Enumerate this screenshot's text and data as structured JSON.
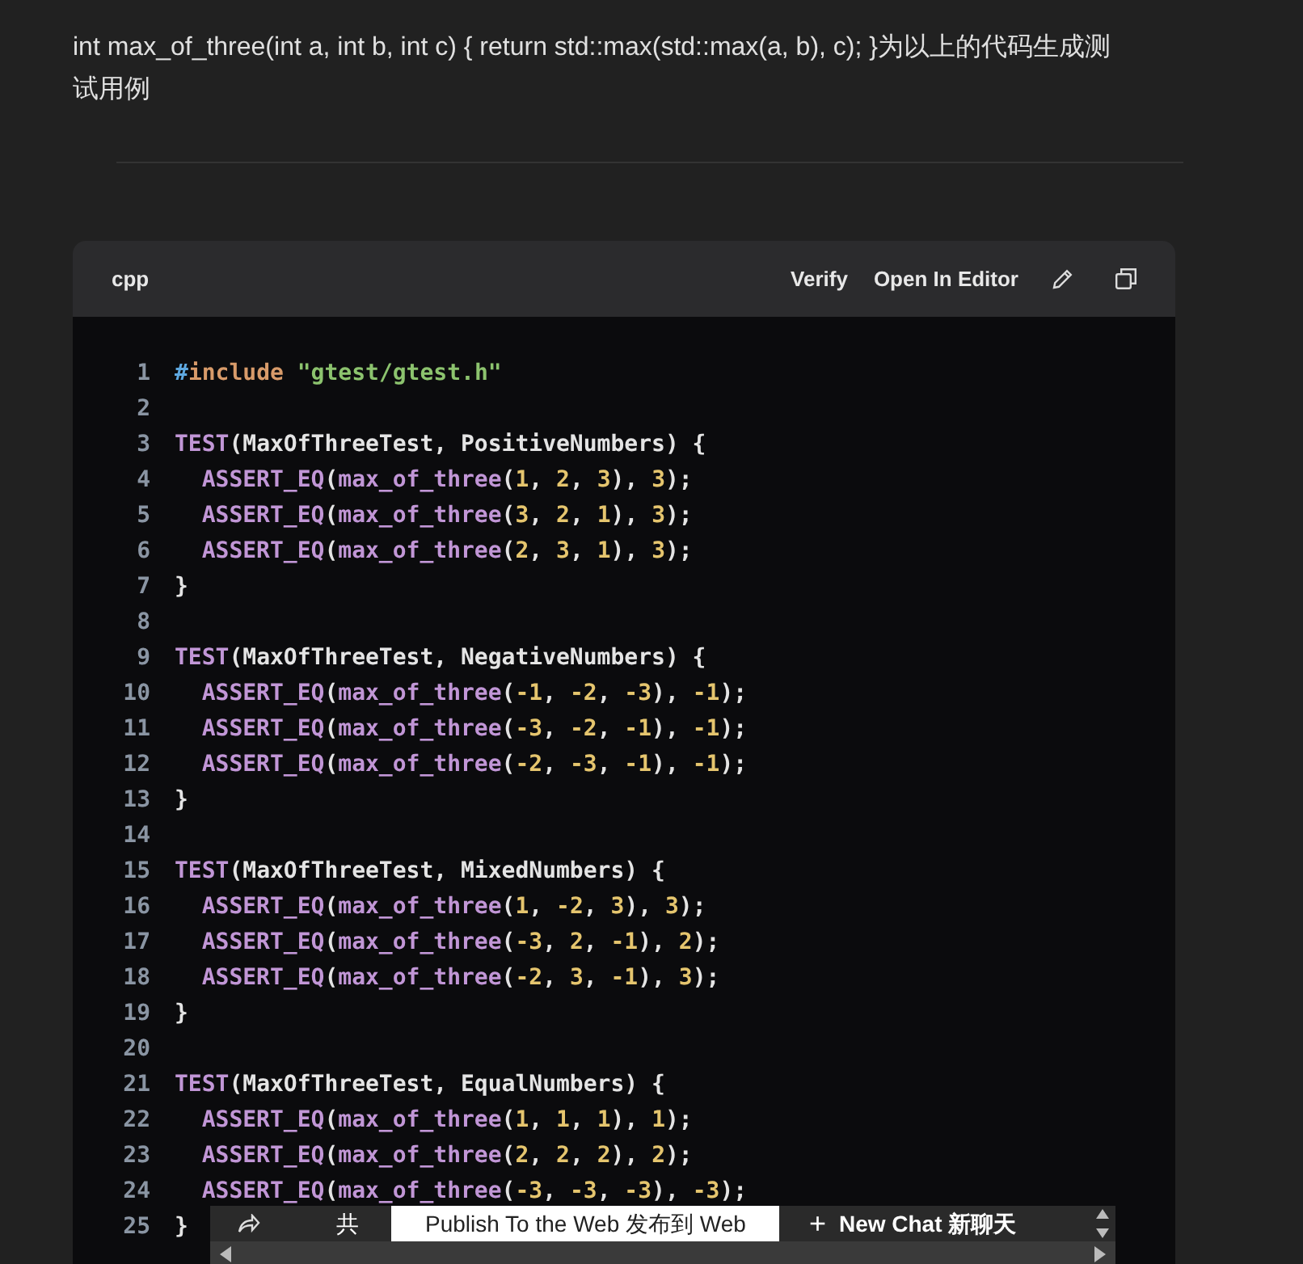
{
  "question": "int max_of_three(int a, int b, int c) { return std::max(std::max(a, b), c); }为以上的代码生成测试用例",
  "code_block": {
    "language": "cpp",
    "actions": [
      "Verify",
      "Open In Editor"
    ],
    "lines": [
      {
        "number": "1",
        "tokens": [
          {
            "kind": "hash",
            "text": "#"
          },
          {
            "kind": "keyword",
            "text": "include"
          },
          {
            "kind": "string",
            "text": " \"gtest/gtest.h\""
          }
        ]
      },
      {
        "number": "2"
      },
      {
        "number": "3",
        "tokens": [
          {
            "kind": "macro",
            "text": "TEST"
          },
          {
            "kind": "plain",
            "text": "(MaxOfThreeTest, PositiveNumbers) {"
          }
        ]
      },
      {
        "number": "4",
        "indented": true,
        "tokens": [
          {
            "kind": "macro",
            "text": "ASSERT_EQ"
          },
          {
            "kind": "plain",
            "text": "("
          },
          {
            "kind": "func",
            "text": "max_of_three"
          },
          {
            "kind": "plain",
            "text": "("
          },
          {
            "kind": "number",
            "text": "1"
          },
          {
            "kind": "plain",
            "text": ", "
          },
          {
            "kind": "number",
            "text": "2"
          },
          {
            "kind": "plain",
            "text": ", "
          },
          {
            "kind": "number",
            "text": "3"
          },
          {
            "kind": "plain",
            "text": "), "
          },
          {
            "kind": "number",
            "text": "3"
          },
          {
            "kind": "plain",
            "text": ");"
          }
        ]
      },
      {
        "number": "5",
        "indented": true,
        "tokens": [
          {
            "kind": "macro",
            "text": "ASSERT_EQ"
          },
          {
            "kind": "plain",
            "text": "("
          },
          {
            "kind": "func",
            "text": "max_of_three"
          },
          {
            "kind": "plain",
            "text": "("
          },
          {
            "kind": "number",
            "text": "3"
          },
          {
            "kind": "plain",
            "text": ", "
          },
          {
            "kind": "number",
            "text": "2"
          },
          {
            "kind": "plain",
            "text": ", "
          },
          {
            "kind": "number",
            "text": "1"
          },
          {
            "kind": "plain",
            "text": "), "
          },
          {
            "kind": "number",
            "text": "3"
          },
          {
            "kind": "plain",
            "text": ");"
          }
        ]
      },
      {
        "number": "6",
        "indented": true,
        "tokens": [
          {
            "kind": "macro",
            "text": "ASSERT_EQ"
          },
          {
            "kind": "plain",
            "text": "("
          },
          {
            "kind": "func",
            "text": "max_of_three"
          },
          {
            "kind": "plain",
            "text": "("
          },
          {
            "kind": "number",
            "text": "2"
          },
          {
            "kind": "plain",
            "text": ", "
          },
          {
            "kind": "number",
            "text": "3"
          },
          {
            "kind": "plain",
            "text": ", "
          },
          {
            "kind": "number",
            "text": "1"
          },
          {
            "kind": "plain",
            "text": "), "
          },
          {
            "kind": "number",
            "text": "3"
          },
          {
            "kind": "plain",
            "text": ");"
          }
        ]
      },
      {
        "number": "7",
        "tokens": [
          {
            "kind": "plain",
            "text": "}"
          }
        ]
      },
      {
        "number": "8"
      },
      {
        "number": "9",
        "tokens": [
          {
            "kind": "macro",
            "text": "TEST"
          },
          {
            "kind": "plain",
            "text": "(MaxOfThreeTest, NegativeNumbers) {"
          }
        ]
      },
      {
        "number": "10",
        "indented": true,
        "tokens": [
          {
            "kind": "macro",
            "text": "ASSERT_EQ"
          },
          {
            "kind": "plain",
            "text": "("
          },
          {
            "kind": "func",
            "text": "max_of_three"
          },
          {
            "kind": "plain",
            "text": "("
          },
          {
            "kind": "number",
            "text": "-1"
          },
          {
            "kind": "plain",
            "text": ", "
          },
          {
            "kind": "number",
            "text": "-2"
          },
          {
            "kind": "plain",
            "text": ", "
          },
          {
            "kind": "number",
            "text": "-3"
          },
          {
            "kind": "plain",
            "text": "), "
          },
          {
            "kind": "number",
            "text": "-1"
          },
          {
            "kind": "plain",
            "text": ");"
          }
        ]
      },
      {
        "number": "11",
        "indented": true,
        "tokens": [
          {
            "kind": "macro",
            "text": "ASSERT_EQ"
          },
          {
            "kind": "plain",
            "text": "("
          },
          {
            "kind": "func",
            "text": "max_of_three"
          },
          {
            "kind": "plain",
            "text": "("
          },
          {
            "kind": "number",
            "text": "-3"
          },
          {
            "kind": "plain",
            "text": ", "
          },
          {
            "kind": "number",
            "text": "-2"
          },
          {
            "kind": "plain",
            "text": ", "
          },
          {
            "kind": "number",
            "text": "-1"
          },
          {
            "kind": "plain",
            "text": "), "
          },
          {
            "kind": "number",
            "text": "-1"
          },
          {
            "kind": "plain",
            "text": ");"
          }
        ]
      },
      {
        "number": "12",
        "indented": true,
        "tokens": [
          {
            "kind": "macro",
            "text": "ASSERT_EQ"
          },
          {
            "kind": "plain",
            "text": "("
          },
          {
            "kind": "func",
            "text": "max_of_three"
          },
          {
            "kind": "plain",
            "text": "("
          },
          {
            "kind": "number",
            "text": "-2"
          },
          {
            "kind": "plain",
            "text": ", "
          },
          {
            "kind": "number",
            "text": "-3"
          },
          {
            "kind": "plain",
            "text": ", "
          },
          {
            "kind": "number",
            "text": "-1"
          },
          {
            "kind": "plain",
            "text": "), "
          },
          {
            "kind": "number",
            "text": "-1"
          },
          {
            "kind": "plain",
            "text": ");"
          }
        ]
      },
      {
        "number": "13",
        "tokens": [
          {
            "kind": "plain",
            "text": "}"
          }
        ]
      },
      {
        "number": "14"
      },
      {
        "number": "15",
        "tokens": [
          {
            "kind": "macro",
            "text": "TEST"
          },
          {
            "kind": "plain",
            "text": "(MaxOfThreeTest, MixedNumbers) {"
          }
        ]
      },
      {
        "number": "16",
        "indented": true,
        "tokens": [
          {
            "kind": "macro",
            "text": "ASSERT_EQ"
          },
          {
            "kind": "plain",
            "text": "("
          },
          {
            "kind": "func",
            "text": "max_of_three"
          },
          {
            "kind": "plain",
            "text": "("
          },
          {
            "kind": "number",
            "text": "1"
          },
          {
            "kind": "plain",
            "text": ", "
          },
          {
            "kind": "number",
            "text": "-2"
          },
          {
            "kind": "plain",
            "text": ", "
          },
          {
            "kind": "number",
            "text": "3"
          },
          {
            "kind": "plain",
            "text": "), "
          },
          {
            "kind": "number",
            "text": "3"
          },
          {
            "kind": "plain",
            "text": ");"
          }
        ]
      },
      {
        "number": "17",
        "indented": true,
        "tokens": [
          {
            "kind": "macro",
            "text": "ASSERT_EQ"
          },
          {
            "kind": "plain",
            "text": "("
          },
          {
            "kind": "func",
            "text": "max_of_three"
          },
          {
            "kind": "plain",
            "text": "("
          },
          {
            "kind": "number",
            "text": "-3"
          },
          {
            "kind": "plain",
            "text": ", "
          },
          {
            "kind": "number",
            "text": "2"
          },
          {
            "kind": "plain",
            "text": ", "
          },
          {
            "kind": "number",
            "text": "-1"
          },
          {
            "kind": "plain",
            "text": "), "
          },
          {
            "kind": "number",
            "text": "2"
          },
          {
            "kind": "plain",
            "text": ");"
          }
        ]
      },
      {
        "number": "18",
        "indented": true,
        "tokens": [
          {
            "kind": "macro",
            "text": "ASSERT_EQ"
          },
          {
            "kind": "plain",
            "text": "("
          },
          {
            "kind": "func",
            "text": "max_of_three"
          },
          {
            "kind": "plain",
            "text": "("
          },
          {
            "kind": "number",
            "text": "-2"
          },
          {
            "kind": "plain",
            "text": ", "
          },
          {
            "kind": "number",
            "text": "3"
          },
          {
            "kind": "plain",
            "text": ", "
          },
          {
            "kind": "number",
            "text": "-1"
          },
          {
            "kind": "plain",
            "text": "), "
          },
          {
            "kind": "number",
            "text": "3"
          },
          {
            "kind": "plain",
            "text": ");"
          }
        ]
      },
      {
        "number": "19",
        "tokens": [
          {
            "kind": "plain",
            "text": "}"
          }
        ]
      },
      {
        "number": "20"
      },
      {
        "number": "21",
        "tokens": [
          {
            "kind": "macro",
            "text": "TEST"
          },
          {
            "kind": "plain",
            "text": "(MaxOfThreeTest, EqualNumbers) {"
          }
        ]
      },
      {
        "number": "22",
        "indented": true,
        "tokens": [
          {
            "kind": "macro",
            "text": "ASSERT_EQ"
          },
          {
            "kind": "plain",
            "text": "("
          },
          {
            "kind": "func",
            "text": "max_of_three"
          },
          {
            "kind": "plain",
            "text": "("
          },
          {
            "kind": "number",
            "text": "1"
          },
          {
            "kind": "plain",
            "text": ", "
          },
          {
            "kind": "number",
            "text": "1"
          },
          {
            "kind": "plain",
            "text": ", "
          },
          {
            "kind": "number",
            "text": "1"
          },
          {
            "kind": "plain",
            "text": "), "
          },
          {
            "kind": "number",
            "text": "1"
          },
          {
            "kind": "plain",
            "text": ");"
          }
        ]
      },
      {
        "number": "23",
        "indented": true,
        "tokens": [
          {
            "kind": "macro",
            "text": "ASSERT_EQ"
          },
          {
            "kind": "plain",
            "text": "("
          },
          {
            "kind": "func",
            "text": "max_of_three"
          },
          {
            "kind": "plain",
            "text": "("
          },
          {
            "kind": "number",
            "text": "2"
          },
          {
            "kind": "plain",
            "text": ", "
          },
          {
            "kind": "number",
            "text": "2"
          },
          {
            "kind": "plain",
            "text": ", "
          },
          {
            "kind": "number",
            "text": "2"
          },
          {
            "kind": "plain",
            "text": "), "
          },
          {
            "kind": "number",
            "text": "2"
          },
          {
            "kind": "plain",
            "text": ");"
          }
        ]
      },
      {
        "number": "24",
        "indented": true,
        "tokens": [
          {
            "kind": "macro",
            "text": "ASSERT_EQ"
          },
          {
            "kind": "plain",
            "text": "("
          },
          {
            "kind": "func",
            "text": "max_of_three"
          },
          {
            "kind": "plain",
            "text": "("
          },
          {
            "kind": "number",
            "text": "-3"
          },
          {
            "kind": "plain",
            "text": ", "
          },
          {
            "kind": "number",
            "text": "-3"
          },
          {
            "kind": "plain",
            "text": ", "
          },
          {
            "kind": "number",
            "text": "-3"
          },
          {
            "kind": "plain",
            "text": "), "
          },
          {
            "kind": "number",
            "text": "-3"
          },
          {
            "kind": "plain",
            "text": ");"
          }
        ]
      },
      {
        "number": "25",
        "tokens": [
          {
            "kind": "plain",
            "text": "}"
          }
        ]
      }
    ]
  },
  "toolbar": {
    "share_label": "共",
    "publish_button": "Publish To the Web 发布到 Web",
    "new_chat_icon": "+",
    "new_chat_button": "New Chat 新聊天"
  }
}
